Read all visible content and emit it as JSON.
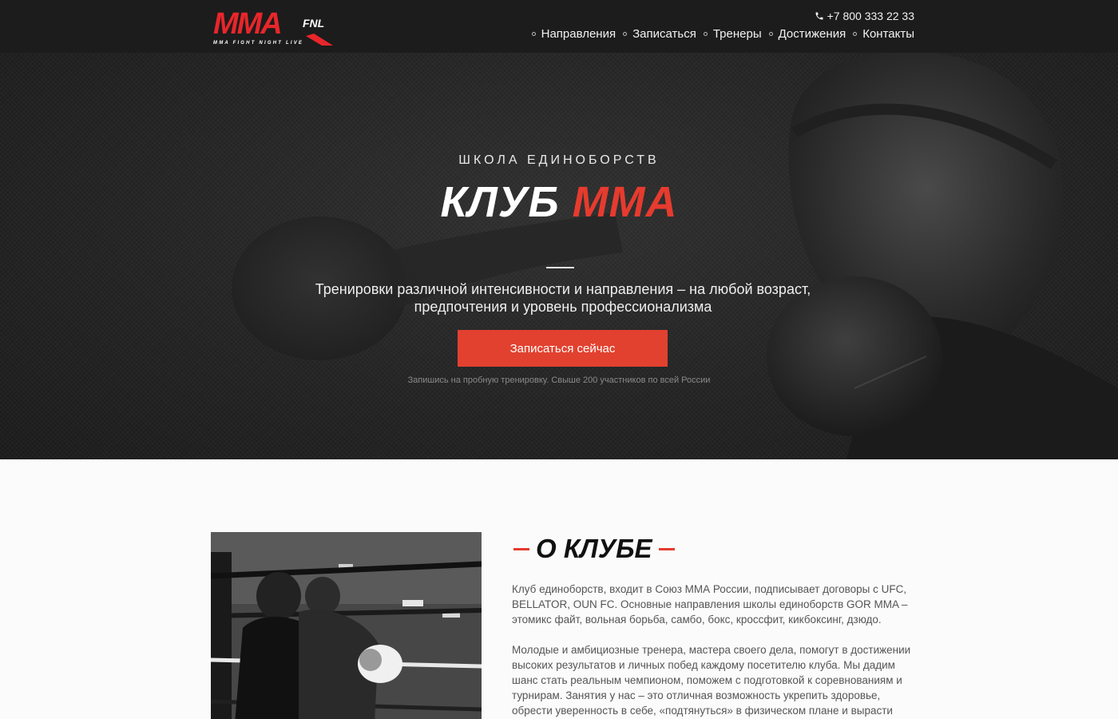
{
  "header": {
    "logo": {
      "main": "MMA",
      "badge": "FNL",
      "tagline": "MMA FIGHT NIGHT LIVE"
    },
    "phone": "+7 800 333 22 33",
    "nav": [
      "Направления",
      "Записаться",
      "Тренеры",
      "Достижения",
      "Контакты"
    ]
  },
  "hero": {
    "subtitle": "ШКОЛА ЕДИНОБОРСТВ",
    "title_white": "КЛУБ",
    "title_red": "ММА",
    "description_line1": "Тренировки различной интенсивности и направления – на любой возраст,",
    "description_line2": "предпочтения и уровень профессионализма",
    "button": "Записаться сейчас",
    "note": "Запишись на пробную тренировку. Свыше 200 участников по всей России"
  },
  "about": {
    "title": "О КЛУБЕ",
    "paragraph1": "Клуб единоборств, входит в Союз ММА России, подписывает договоры с UFC, BELLATOR, OUN FC. Основные направления школы единоборств GOR MMA – этомикс файт, вольная борьба, самбо, бокс, кроссфит, кикбоксинг, дзюдо.",
    "paragraph2": "Молодые и амбициозные тренера, мастера своего дела, помогут в достижении высоких результатов и личных побед каждому посетителю клуба. Мы дадим шанс стать реальным чемпионом, поможем с подготовкой к соревнованиям и турнирам. Занятия у нас – это отличная возможность укрепить здоровье, обрести уверенность в себе, «подтянуться» в физическом плане и вырасти"
  },
  "colors": {
    "accent": "#e63b2e",
    "button": "#e2412f",
    "header_bg": "#1c1c1c"
  },
  "icons": {
    "phone": "phone-icon",
    "nav_bullet": "bullet-icon"
  }
}
